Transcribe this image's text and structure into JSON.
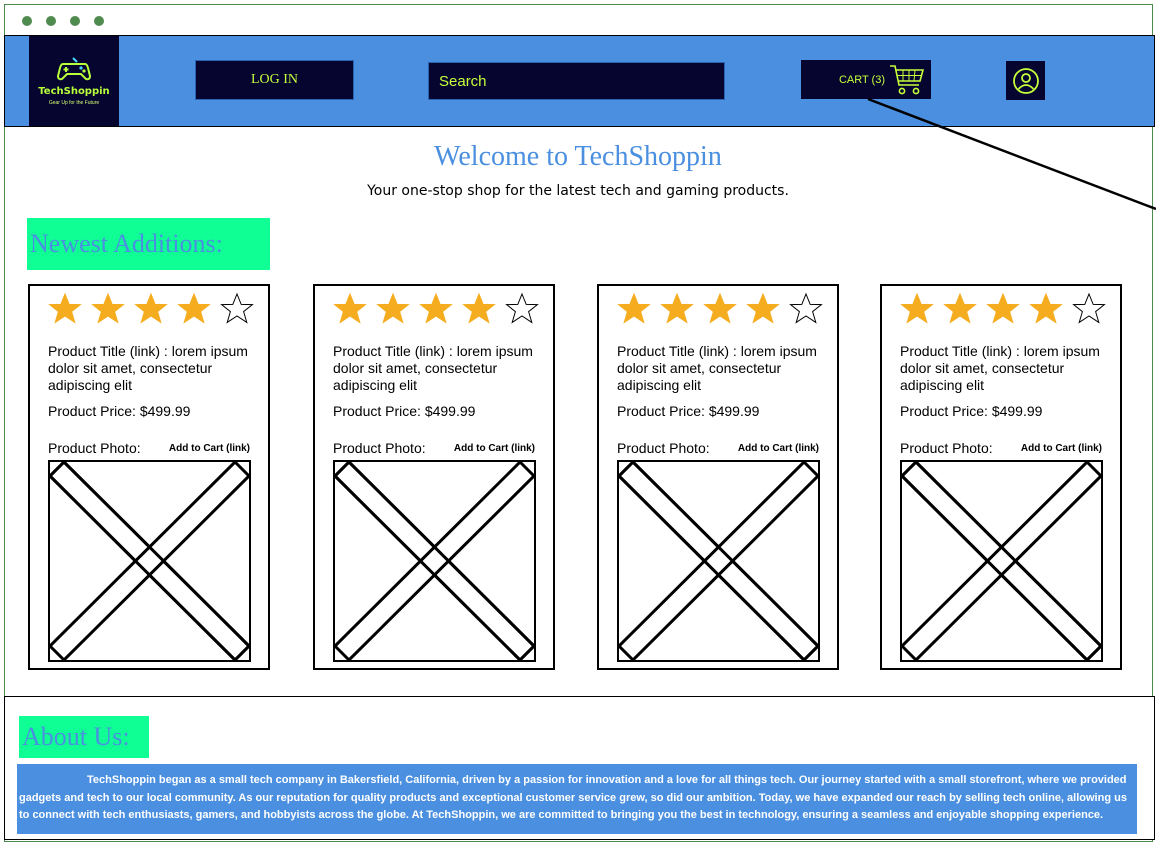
{
  "brand": {
    "name": "TechShoppin",
    "tagline": "Gear Up for the Future",
    "accent": "#4a8fe0",
    "dark": "#050530",
    "lime": "#c6ff3a",
    "mint": "#0fff95"
  },
  "header": {
    "login_label": "LOG IN",
    "search_placeholder": "Search",
    "cart_label": "CART (3)"
  },
  "hero": {
    "title": "Welcome to TechShoppin",
    "subtitle": "Your one-stop shop for the latest tech and gaming products."
  },
  "newest": {
    "heading": "Newest Additions:",
    "products": [
      {
        "title": "Product Title (link) : lorem ipsum dolor sit amet, consectetur adipiscing elit",
        "price": "Product Price: $499.99",
        "photo_label": "Product Photo:",
        "add_to_cart": "Add to Cart (link)",
        "rating": 4,
        "max_rating": 5
      },
      {
        "title": "Product Title (link) : lorem ipsum dolor sit amet, consectetur adipiscing elit",
        "price": "Product Price: $499.99",
        "photo_label": "Product Photo:",
        "add_to_cart": "Add to Cart (link)",
        "rating": 4,
        "max_rating": 5
      },
      {
        "title": "Product Title (link) : lorem ipsum dolor sit amet, consectetur adipiscing elit",
        "price": "Product Price: $499.99",
        "photo_label": "Product Photo:",
        "add_to_cart": "Add to Cart (link)",
        "rating": 4,
        "max_rating": 5
      },
      {
        "title": "Product Title (link) : lorem ipsum dolor sit amet, consectetur adipiscing elit",
        "price": "Product Price: $499.99",
        "photo_label": "Product Photo:",
        "add_to_cart": "Add to Cart (link)",
        "rating": 4,
        "max_rating": 5
      }
    ]
  },
  "about": {
    "heading": "About Us:",
    "text": "TechShoppin began as a small tech company in Bakersfield, California, driven by a passion for innovation and a love for all things tech. Our journey started with a small storefront, where we provided gadgets and tech to our local community. As our reputation for quality products and exceptional customer service grew, so did our ambition. Today, we have expanded our reach by selling tech online, allowing us to connect with tech enthusiasts, gamers, and hobbyists across the globe. At TechShoppin, we are committed to bringing you the best in technology, ensuring a seamless and enjoyable shopping experience."
  },
  "icons": {
    "window_controls": "window-dots",
    "logo": "gamepad-icon",
    "cart": "shopping-cart-icon",
    "profile": "user-profile-icon",
    "rating": "star-icon",
    "placeholder": "image-placeholder-icon"
  }
}
